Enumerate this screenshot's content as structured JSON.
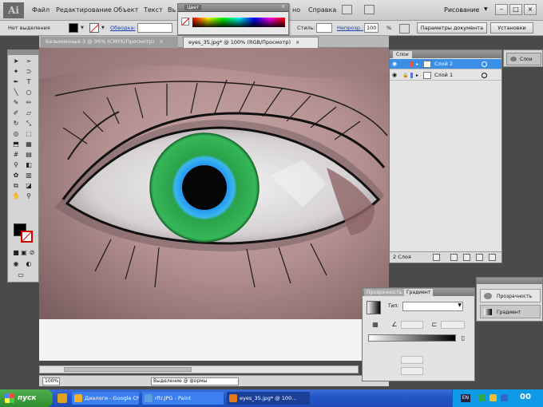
{
  "app": {
    "logo": "Ai",
    "menu": [
      "Файл",
      "Редактирование",
      "Объект",
      "Текст",
      "Вь",
      "но",
      "Справка"
    ],
    "workspace": "Рисование"
  },
  "control_bar": {
    "selection_label": "Нет выделения",
    "stroke_label": "Обводка:",
    "style_label": "Стиль:",
    "opacity_label": "Непрозр.:",
    "opacity_value": "100",
    "percent": "%",
    "doc_settings_button": "Параметры документа",
    "settings_button": "Установки"
  },
  "color_panel": {
    "title": "Цвет",
    "close": "×"
  },
  "documents": {
    "tabs": [
      {
        "label": "Безымянный-3 @ 96% (CMYK/Просмотр)",
        "active": false
      },
      {
        "label": "eyes_35.jpg* @ 100% (RGB/Просмотр)",
        "active": true
      }
    ],
    "close": "×"
  },
  "status_bar": {
    "zoom": "100%",
    "info": "Выделение @ формы"
  },
  "layers_panel": {
    "tab": "Слои",
    "layers": [
      {
        "name": "Слой 2",
        "color": "#e25555",
        "selected": true
      },
      {
        "name": "Слой 1",
        "color": "#5577dd",
        "selected": false
      }
    ],
    "count": "2 Слоя"
  },
  "dock": {
    "collapsed_item": "Слои",
    "expanded_items": [
      "Прозрачность",
      "Градиент"
    ]
  },
  "gradient_panel": {
    "tabs": [
      "Прозрачность",
      "Градиент"
    ],
    "type_label": "Тип:",
    "type_value": "",
    "angle_label": "",
    "location_label": ""
  },
  "taskbar": {
    "start": "пуск",
    "tasks": [
      {
        "label": "Диалоги - Google Ch...",
        "active": false,
        "icon_color": "#e8b12e"
      },
      {
        "label": "rftr.JPG - Paint",
        "active": false,
        "icon_color": "#5aa0e0"
      },
      {
        "label": "eyes_35.jpg* @ 100...",
        "active": true,
        "icon_color": "#e07a1a"
      }
    ],
    "lang": "EN",
    "clock": "00"
  },
  "colors": {
    "accent": "#3a8ee6",
    "iris_outer": "#2aa24b",
    "iris_inner": "#1f8ef0",
    "taskbar": "#2456c6"
  }
}
